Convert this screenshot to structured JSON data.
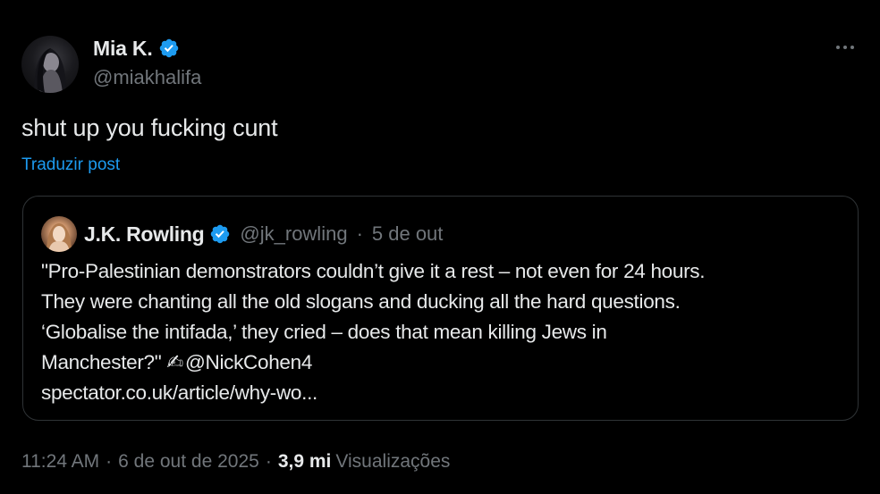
{
  "post": {
    "author": {
      "display_name": "Mia K.",
      "handle": "@miakhalifa",
      "verified": true,
      "avatar_icon": "profile-photo"
    },
    "text": "shut up you fucking cunt",
    "translate_label": "Traduzir post",
    "more_icon": "ellipsis-icon"
  },
  "quote": {
    "author": {
      "display_name": "J.K. Rowling",
      "handle": "@jk_rowling",
      "verified": true
    },
    "date": "5 de out",
    "separator": "·",
    "lines": [
      "\"Pro-Palestinian demonstrators couldn’t give it a rest – not even for 24 hours.",
      "They were chanting all the old slogans and ducking all the hard questions.",
      "‘Globalise the intifada,’ they cried – does that mean killing Jews in"
    ],
    "last_line_prefix": "Manchester?\" ",
    "emoji": "✍",
    "mention": "@NickCohen4",
    "link": "spectator.co.uk/article/why-wo..."
  },
  "footer": {
    "time": "11:24 AM",
    "date": "6 de out de 2025",
    "separator": "·",
    "views_count": "3,9 mi",
    "views_label": "Visualizações"
  },
  "colors": {
    "background": "#000000",
    "text_primary": "#e7e9ea",
    "text_secondary": "#71767b",
    "accent": "#1d9bf0",
    "border": "#2f3336"
  }
}
